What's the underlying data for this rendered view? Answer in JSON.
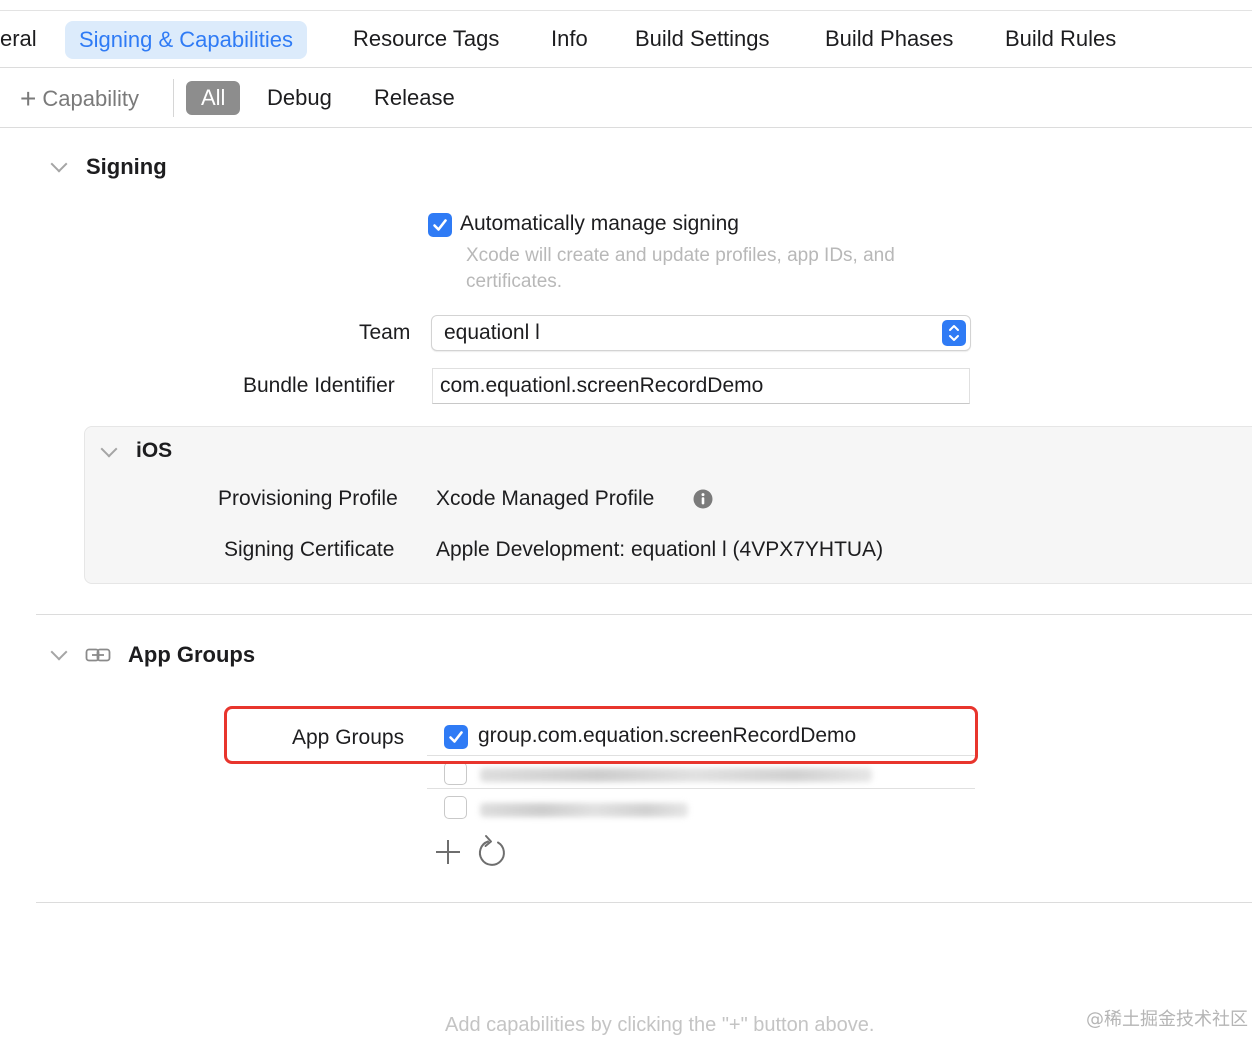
{
  "tabs": [
    {
      "label": "eral"
    },
    {
      "label": "Signing & Capabilities",
      "active": true
    },
    {
      "label": "Resource Tags"
    },
    {
      "label": "Info"
    },
    {
      "label": "Build Settings"
    },
    {
      "label": "Build Phases"
    },
    {
      "label": "Build Rules"
    }
  ],
  "filter": {
    "add_capability": "Capability",
    "segments": [
      "All",
      "Debug",
      "Release"
    ],
    "selected": "All"
  },
  "signing": {
    "title": "Signing",
    "auto_manage_label": "Automatically manage signing",
    "auto_manage_checked": true,
    "auto_manage_help": "Xcode will create and update profiles, app IDs, and certificates.",
    "team_label": "Team",
    "team_value": "equationl l",
    "bundle_label": "Bundle Identifier",
    "bundle_value": "com.equationl.screenRecordDemo",
    "ios": {
      "title": "iOS",
      "profile_label": "Provisioning Profile",
      "profile_value": "Xcode Managed Profile",
      "certificate_label": "Signing Certificate",
      "certificate_value": "Apple Development: equationl l (4VPX7YHTUA)"
    }
  },
  "app_groups": {
    "title": "App Groups",
    "field_label": "App Groups",
    "groups": [
      {
        "id": "group.com.equation.screenRecordDemo",
        "checked": true
      }
    ]
  },
  "footer_hint": "Add capabilities by clicking the \"+\" button above.",
  "watermark": "@稀土掘金技术社区",
  "colors": {
    "accent": "#2f7bf5",
    "active_tab_bg": "#dcebfb",
    "highlight": "#e8352d"
  },
  "icons": [
    "plus-icon",
    "chevron-down-icon",
    "checkmark-icon",
    "popup-arrows-icon",
    "info-icon",
    "link-icon",
    "refresh-icon"
  ]
}
